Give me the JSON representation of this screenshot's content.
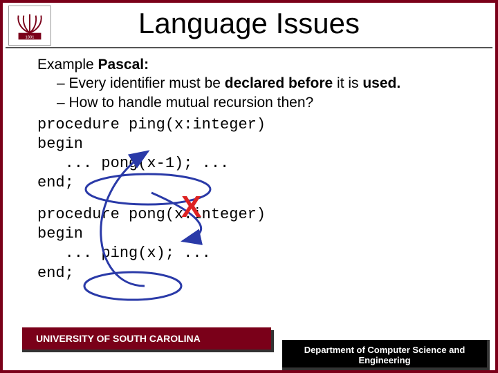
{
  "title": "Language Issues",
  "example_label": "Example ",
  "example_lang": "Pascal:",
  "bullet1_a": "Every identifier must be ",
  "bullet1_b": "declared before",
  "bullet1_c": " it is ",
  "bullet1_d": "used.",
  "bullet2": "How to handle mutual recursion then?",
  "code1_l1": "procedure ping(x:integer)",
  "code1_l2": "begin",
  "code1_l3": "   ... pong(x-1); ...",
  "code1_l4": "end;",
  "code2_l1": "procedure pong(x:integer)",
  "code2_l2": "begin",
  "code2_l3": "   ... ping(x); ...",
  "code2_l4": "end;",
  "x_mark": "X",
  "banner_left": "UNIVERSITY OF SOUTH CAROLINA",
  "banner_right_l1": "Department of Computer Science and",
  "banner_right_l2": "Engineering",
  "logo_name": "usc-logo"
}
